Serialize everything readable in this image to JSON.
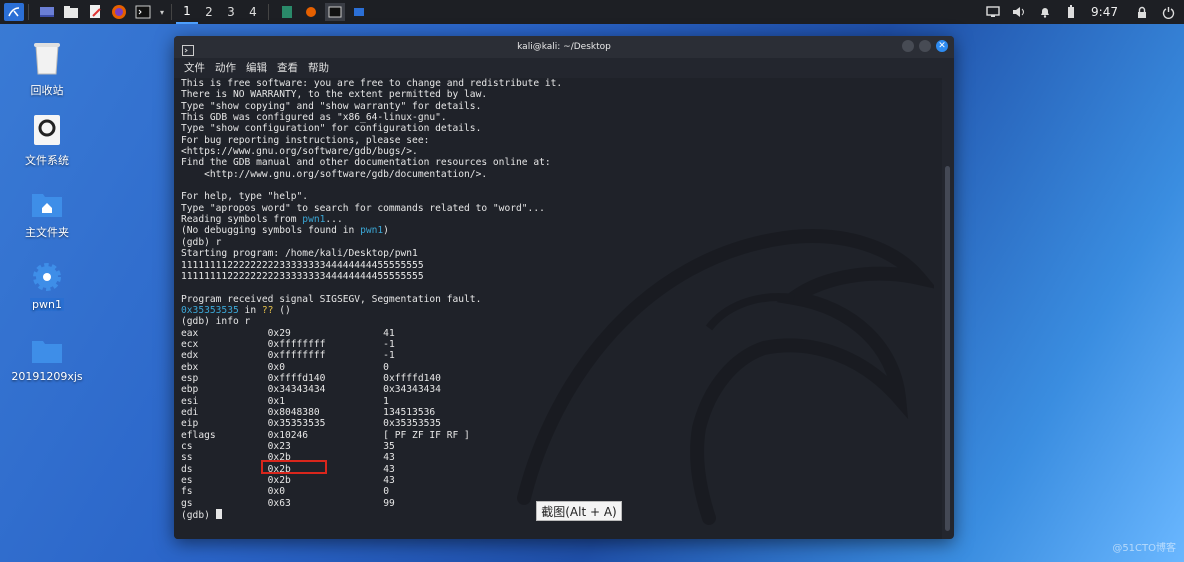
{
  "panel": {
    "workspaces": [
      "1",
      "2",
      "3",
      "4"
    ],
    "clock": "9:47"
  },
  "desktop": {
    "icons": [
      "回收站",
      "文件系统",
      "主文件夹",
      "pwn1",
      "20191209xjs"
    ]
  },
  "window": {
    "title": "kali@kali: ~/Desktop",
    "menu": [
      "文件",
      "动作",
      "编辑",
      "查看",
      "帮助"
    ]
  },
  "terminal": {
    "intro": [
      "This is free software: you are free to change and redistribute it.",
      "There is NO WARRANTY, to the extent permitted by law.",
      "Type \"show copying\" and \"show warranty\" for details.",
      "This GDB was configured as \"x86_64-linux-gnu\".",
      "Type \"show configuration\" for configuration details.",
      "For bug reporting instructions, please see:",
      "<https://www.gnu.org/software/gdb/bugs/>.",
      "Find the GDB manual and other documentation resources online at:",
      "    <http://www.gnu.org/software/gdb/documentation/>.",
      "",
      "For help, type \"help\".",
      "Type \"apropos word\" to search for commands related to \"word\"..."
    ],
    "reading_prefix": "Reading symbols from ",
    "reading_file": "pwn1",
    "reading_suffix": "...",
    "nodebug_prefix": "(No debugging symbols found in ",
    "nodebug_file": "pwn1",
    "nodebug_suffix": ")",
    "run_lines": [
      "(gdb) r",
      "Starting program: /home/kali/Desktop/pwn1",
      "111111112222222223333333344444444455555555",
      "111111112222222223333333344444444455555555",
      "",
      "Program received signal SIGSEGV, Segmentation fault."
    ],
    "fault_addr": "0x35353535",
    "fault_in": " in ",
    "fault_fn": "??",
    "fault_args": " ()",
    "info_cmd": "(gdb) info r",
    "registers": [
      [
        "eax",
        "0x29",
        "41"
      ],
      [
        "ecx",
        "0xffffffff",
        "-1"
      ],
      [
        "edx",
        "0xffffffff",
        "-1"
      ],
      [
        "ebx",
        "0x0",
        "0"
      ],
      [
        "esp",
        "0xffffd140",
        "0xffffd140"
      ],
      [
        "ebp",
        "0x34343434",
        "0x34343434"
      ],
      [
        "esi",
        "0x1",
        "1"
      ],
      [
        "edi",
        "0x8048380",
        "134513536"
      ],
      [
        "eip",
        "0x35353535",
        "0x35353535"
      ],
      [
        "eflags",
        "0x10246",
        "[ PF ZF IF RF ]"
      ],
      [
        "cs",
        "0x23",
        "35"
      ],
      [
        "ss",
        "0x2b",
        "43"
      ],
      [
        "ds",
        "0x2b",
        "43"
      ],
      [
        "es",
        "0x2b",
        "43"
      ],
      [
        "fs",
        "0x0",
        "0"
      ],
      [
        "gs",
        "0x63",
        "99"
      ]
    ],
    "prompt": "(gdb) "
  },
  "tooltip": "截图(Alt + A)",
  "watermark": "@51CTO博客",
  "colors": {
    "highlight_box": "#d9261c",
    "accent": "#2e8bf0",
    "cyan_text": "#3ba7d6"
  }
}
